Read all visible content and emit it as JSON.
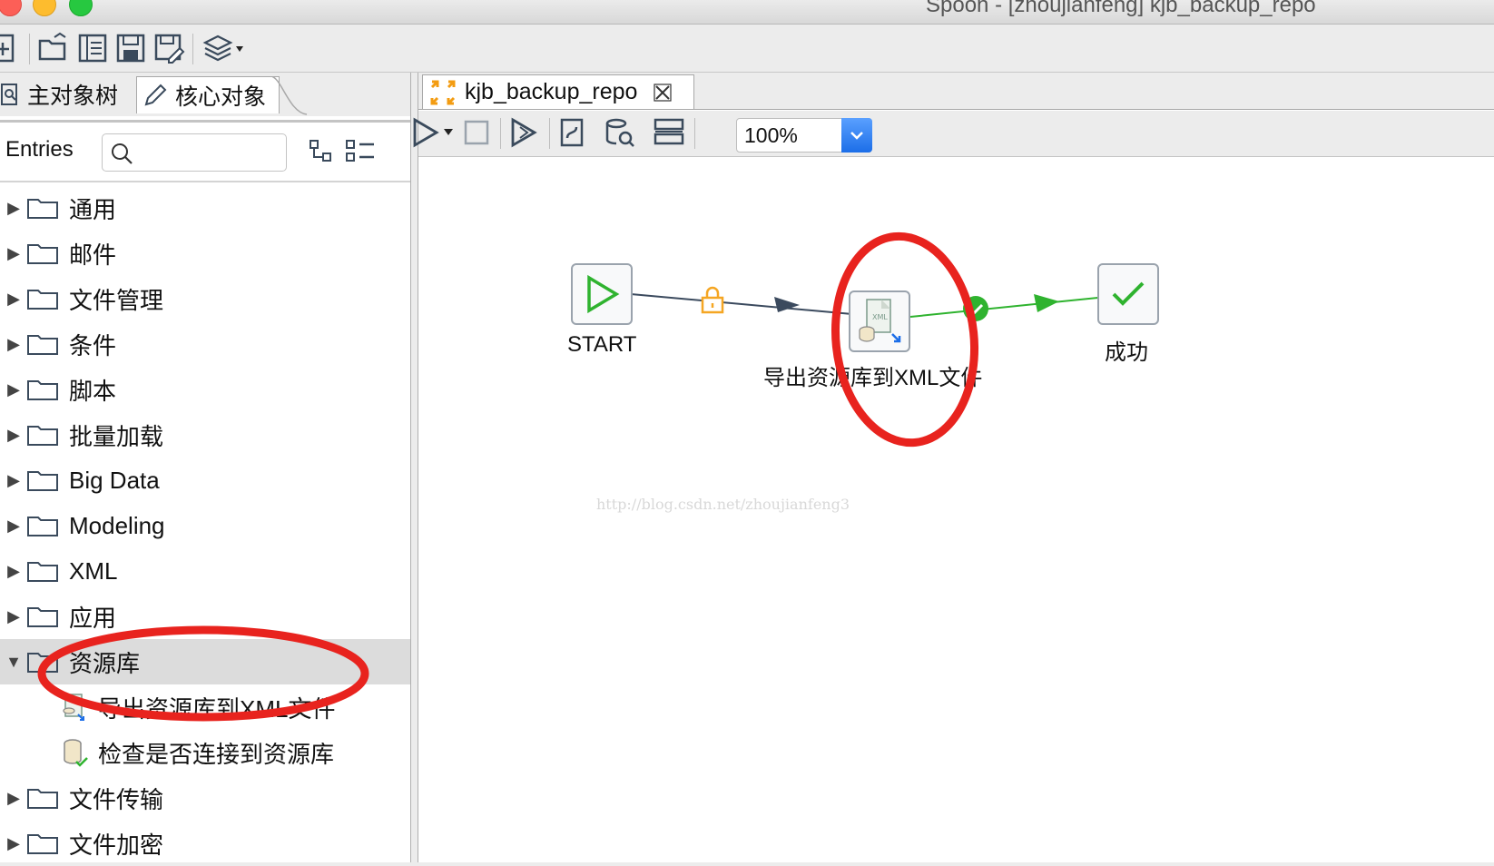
{
  "window": {
    "title": "Spoon - [zhoujianfeng] kjb_backup_repo"
  },
  "left_panel": {
    "tabs": [
      {
        "label": "主对象树"
      },
      {
        "label": "核心对象"
      }
    ],
    "entries_label": "Entries",
    "search_placeholder": "",
    "tree": [
      {
        "label": "通用",
        "expanded": false
      },
      {
        "label": "邮件",
        "expanded": false
      },
      {
        "label": "文件管理",
        "expanded": false
      },
      {
        "label": "条件",
        "expanded": false
      },
      {
        "label": "脚本",
        "expanded": false
      },
      {
        "label": "批量加载",
        "expanded": false
      },
      {
        "label": "Big Data",
        "expanded": false
      },
      {
        "label": "Modeling",
        "expanded": false
      },
      {
        "label": "XML",
        "expanded": false
      },
      {
        "label": "应用",
        "expanded": false
      },
      {
        "label": "资源库",
        "expanded": true,
        "children": [
          {
            "label": "导出资源库到XML文件",
            "icon": "xml-export-icon"
          },
          {
            "label": "检查是否连接到资源库",
            "icon": "database-check-icon"
          }
        ]
      },
      {
        "label": "文件传输",
        "expanded": false
      },
      {
        "label": "文件加密",
        "expanded": false
      }
    ]
  },
  "editor": {
    "tab_label": "kjb_backup_repo",
    "zoom": "100%",
    "nodes": {
      "start": {
        "label": "START"
      },
      "export": {
        "label": "导出资源库到XML文件"
      },
      "success": {
        "label": "成功"
      }
    },
    "watermark": "http://blog.csdn.net/zhoujianfeng3"
  },
  "colors": {
    "accent": "#1c6ee8",
    "highlight_circle": "#e8231e",
    "hop_success": "#2fb32f",
    "hop_normal": "#3b4a5e",
    "lock": "#f5a623"
  }
}
